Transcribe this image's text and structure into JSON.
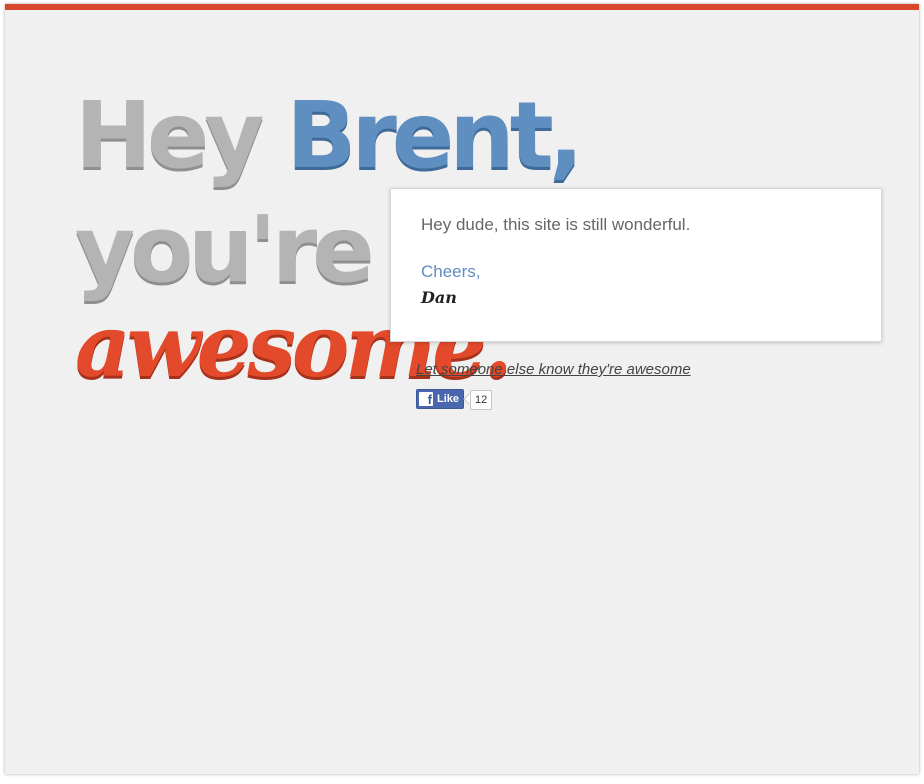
{
  "colors": {
    "accent_bar": "#d9472b",
    "greeting_gray": "#b4b4b4",
    "name_blue": "#5f8ec0",
    "awesome_red": "#e24a2b",
    "background": "#f0f0f0"
  },
  "headline": {
    "greeting": "Hey",
    "name": "Brent,",
    "line2": "you're",
    "line3": "awesome."
  },
  "card": {
    "message": "Hey dude, this site is still wonderful.",
    "signoff": "Cheers,",
    "signature": "Dan"
  },
  "share": {
    "link_text": "Let someone else know they're awesome"
  },
  "facebook": {
    "icon": "facebook-f-icon",
    "f_glyph": "f",
    "like_label": "Like",
    "like_count": "12"
  }
}
